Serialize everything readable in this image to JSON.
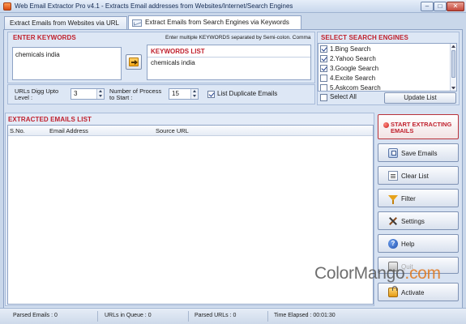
{
  "window": {
    "title": "Web Email Extractor Pro v4.1 - Extracts Email addresses from Websites/Internet/Search Engines",
    "minimize": "–",
    "maximize": "□",
    "close": "✕"
  },
  "tabs": [
    {
      "label": "Extract Emails from Websites via URL",
      "active": false
    },
    {
      "label": "Extract Emails from Search Engines via Keywords",
      "active": true
    }
  ],
  "keywords": {
    "section_title": "ENTER KEYWORDS",
    "hint": "Enter multiple KEYWORDS separated by Semi-colon. Comma",
    "input_value": "chemicals india",
    "list_title": "KEYWORDS LIST",
    "list_items": [
      "chemicals india"
    ]
  },
  "options": {
    "dig_label": "URLs Digg Upto Level :",
    "dig_value": "3",
    "process_label": "Number of Process to Start :",
    "process_value": "15",
    "duplicate_label": "List Duplicate Emails",
    "duplicate_checked": true
  },
  "engines": {
    "section_title": "SELECT SEARCH ENGINES",
    "items": [
      {
        "label": "1.Bing Search",
        "checked": true
      },
      {
        "label": "2.Yahoo Search",
        "checked": true
      },
      {
        "label": "3.Google Search",
        "checked": true
      },
      {
        "label": "4.Excite Search",
        "checked": false
      },
      {
        "label": "5.Askcom Search",
        "checked": false
      }
    ],
    "select_all_label": "Select All",
    "update_label": "Update List"
  },
  "results": {
    "section_title": "EXTRACTED EMAILS LIST",
    "columns": [
      "S.No.",
      "Email Address",
      "Source URL"
    ]
  },
  "actions": {
    "start": "START EXTRACTING EMAILS",
    "save": "Save Emails",
    "clear": "Clear List",
    "filter": "Filter",
    "settings": "Settings",
    "help": "Help",
    "exit": "Quit",
    "activate": "Activate",
    "help_glyph": "?"
  },
  "status": {
    "parsed_emails": "Parsed Emails :  0",
    "urls_in_queue": "URLs in Queue :  0",
    "parsed_urls": "Parsed URLs :  0",
    "time_elapsed": "Time Elapsed :    00:01:30"
  },
  "watermark": {
    "part1": "ColorMango",
    "part2": ".com"
  }
}
